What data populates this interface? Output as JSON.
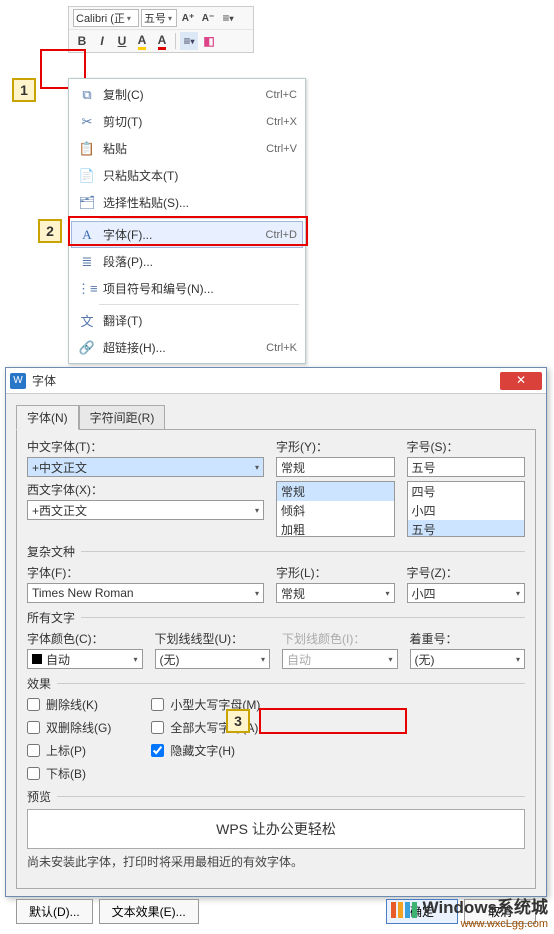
{
  "toolbar": {
    "font_name": "Calibri (正",
    "font_size": "五号",
    "inc_font": "A⁺",
    "dec_font": "A⁻",
    "bold": "B",
    "italic": "I",
    "underline": "U"
  },
  "steps": {
    "s1": "1",
    "s2": "2",
    "s3": "3"
  },
  "cmenu": {
    "copy": "复制(C)",
    "copy_sc": "Ctrl+C",
    "cut": "剪切(T)",
    "cut_sc": "Ctrl+X",
    "paste": "粘贴",
    "paste_sc": "Ctrl+V",
    "paste_text": "只粘贴文本(T)",
    "paste_special": "选择性粘贴(S)...",
    "font": "字体(F)...",
    "font_sc": "Ctrl+D",
    "paragraph": "段落(P)...",
    "bullets": "项目符号和编号(N)...",
    "translate": "翻译(T)",
    "hyperlink": "超链接(H)...",
    "hyperlink_sc": "Ctrl+K"
  },
  "dialog": {
    "title": "字体",
    "tab_font": "字体(N)",
    "tab_spacing": "字符间距(R)",
    "cn_font_label": "中文字体(T)：",
    "cn_font_value": "+中文正文",
    "style_label": "字形(Y)：",
    "style_value": "常规",
    "style_opts": [
      "常规",
      "倾斜",
      "加粗"
    ],
    "size_label": "字号(S)：",
    "size_value": "五号",
    "size_opts": [
      "四号",
      "小四",
      "五号"
    ],
    "west_font_label": "西文字体(X)：",
    "west_font_value": "+西文正文",
    "complex_label": "复杂文种",
    "cx_font_label": "字体(F)：",
    "cx_font_value": "Times New Roman",
    "cx_style_label": "字形(L)：",
    "cx_style_value": "常规",
    "cx_size_label": "字号(Z)：",
    "cx_size_value": "小四",
    "all_text_label": "所有文字",
    "color_label": "字体颜色(C)：",
    "color_value": "自动",
    "ul_label": "下划线线型(U)：",
    "ul_value": "(无)",
    "ul_color_label": "下划线颜色(I)：",
    "ul_color_value": "自动",
    "emphasis_label": "着重号：",
    "emphasis_value": "(无)",
    "effects_label": "效果",
    "strike": "删除线(K)",
    "dstrike": "双删除线(G)",
    "super": "上标(P)",
    "sub": "下标(B)",
    "smallcaps": "小型大写字母(M)",
    "allcaps": "全部大写字母(A)",
    "hidden": "隐藏文字(H)",
    "preview_label": "预览",
    "preview_text": "WPS 让办公更轻松",
    "hint": "尚未安装此字体，打印时将采用最相近的有效字体。",
    "btn_default": "默认(D)...",
    "btn_texteffect": "文本效果(E)...",
    "btn_ok": "确定",
    "btn_cancel": "取消"
  },
  "watermark": {
    "title": "Windows系统城",
    "url": "www.wxcLgg.com"
  }
}
